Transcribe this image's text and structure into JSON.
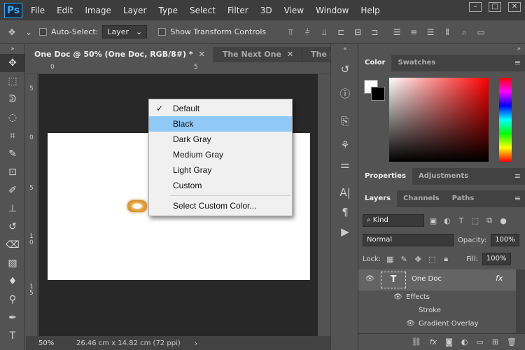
{
  "menubar": {
    "logo": "Ps",
    "items": [
      "File",
      "Edit",
      "Image",
      "Layer",
      "Type",
      "Select",
      "Filter",
      "3D",
      "View",
      "Window",
      "Help"
    ],
    "window_controls": [
      "–",
      "□",
      "✕"
    ]
  },
  "options": {
    "auto_select_label": "Auto-Select:",
    "auto_select_target": "Layer",
    "show_transform_label": "Show Transform Controls"
  },
  "tabs": [
    {
      "label": "One Doc @ 50% (One Doc, RGB/8#) *",
      "close": "✕"
    },
    {
      "label": "The Next One",
      "close": "✕"
    },
    {
      "label": "The Las",
      "close": ""
    }
  ],
  "tabs_overflow": "»",
  "ruler_top": [
    "0",
    "5"
  ],
  "ruler_left": [
    "5",
    "0",
    "5",
    "1\n0",
    "1\n5"
  ],
  "status": {
    "zoom": "50%",
    "doc_size": "26.46 cm x 14.82 cm (72 ppi)",
    "arrow": "›"
  },
  "context_menu": {
    "items": [
      {
        "label": "Default",
        "checked": true,
        "highlight": false
      },
      {
        "label": "Black",
        "checked": false,
        "highlight": true
      },
      {
        "label": "Dark Gray",
        "checked": false,
        "highlight": false
      },
      {
        "label": "Medium Gray",
        "checked": false,
        "highlight": false
      },
      {
        "label": "Light Gray",
        "checked": false,
        "highlight": false
      },
      {
        "label": "Custom",
        "checked": false,
        "highlight": false
      }
    ],
    "extra": "Select Custom Color...",
    "check_glyph": "✓"
  },
  "panels": {
    "color_tabs": [
      "Color",
      "Swatches"
    ],
    "properties_tabs": [
      "Properties",
      "Adjustments"
    ],
    "layers_tabs": [
      "Layers",
      "Channels",
      "Paths"
    ],
    "menu_glyph": "≡"
  },
  "layers": {
    "filter_kind": "Kind",
    "blend_mode": "Normal",
    "opacity_label": "Opacity:",
    "opacity_value": "100%",
    "lock_label": "Lock:",
    "fill_label": "Fill:",
    "fill_value": "100%",
    "layer_name": "One Doc",
    "fx": "fx",
    "effects_label": "Effects",
    "stroke_label": "Stroke",
    "gradient_label": "Gradient Overlay"
  }
}
